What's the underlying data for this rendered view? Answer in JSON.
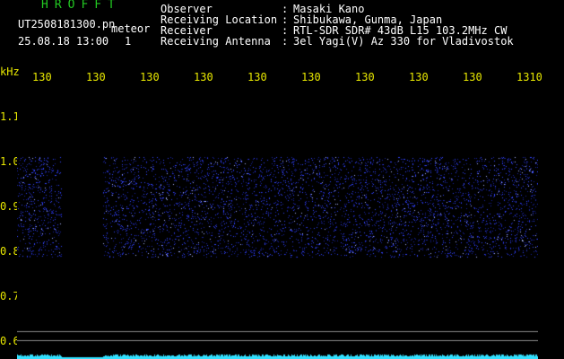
{
  "header": {
    "app_title": "HROFFT",
    "filename": "UT2508181300.pn",
    "event_label": "meteor",
    "datetime": "25.08.18 13:00",
    "event_count": "1"
  },
  "metadata": [
    {
      "key": "Observer",
      "value": "Masaki Kano"
    },
    {
      "key": "Receiving Location",
      "value": "Shibukawa, Gunma, Japan"
    },
    {
      "key": "Receiver",
      "value": "RTL-SDR SDR# 43dB L15 103.2MHz CW"
    },
    {
      "key": "Receiving Antenna",
      "value": "3el Yagi(V) Az 330 for Vladivostok"
    }
  ],
  "separator": ":",
  "axis": {
    "y_unit": "kHz",
    "x_ticks": [
      "130",
      "130",
      "130",
      "130",
      "130",
      "130",
      "130",
      "130",
      "130",
      "1310"
    ],
    "y_ticks": [
      "1.1",
      "1.0",
      "0.9",
      "0.8",
      "0.7",
      "0.6"
    ]
  },
  "colors": {
    "background": "#000000",
    "title": "#22c922",
    "axis_labels": "#e8e800",
    "signal": "#3344ff",
    "signal_bright": "#aab4ff",
    "power_trace": "#33e0ff",
    "grid_line": "#888888"
  }
}
